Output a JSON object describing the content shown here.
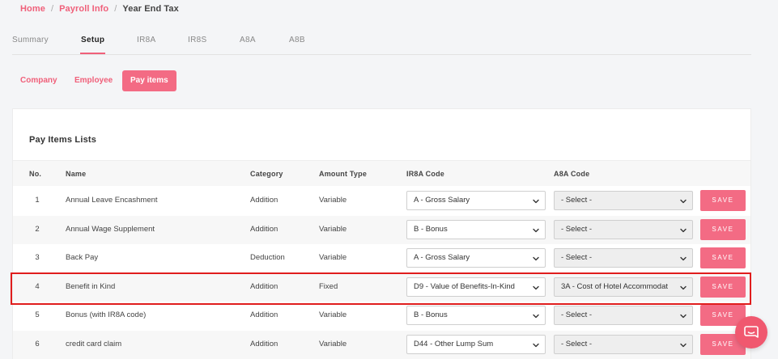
{
  "breadcrumb": {
    "home": "Home",
    "payroll": "Payroll Info",
    "current": "Year End Tax"
  },
  "tabs": [
    "Summary",
    "Setup",
    "IR8A",
    "IR8S",
    "A8A",
    "A8B"
  ],
  "active_tab": "Setup",
  "subtabs": [
    "Company",
    "Employee",
    "Pay items"
  ],
  "active_subtab": "Pay items",
  "card_title": "Pay Items Lists",
  "columns": {
    "no": "No.",
    "name": "Name",
    "category": "Category",
    "amount_type": "Amount Type",
    "ir8a": "IR8A Code",
    "a8a": "A8A Code"
  },
  "rows": [
    {
      "no": "1",
      "name": "Annual Leave Encashment",
      "category": "Addition",
      "amount_type": "Variable",
      "ir8a": "A - Gross Salary",
      "a8a": "- Select -",
      "save": "SAVE"
    },
    {
      "no": "2",
      "name": "Annual Wage Supplement",
      "category": "Addition",
      "amount_type": "Variable",
      "ir8a": "B - Bonus",
      "a8a": "- Select -",
      "save": "SAVE"
    },
    {
      "no": "3",
      "name": "Back Pay",
      "category": "Deduction",
      "amount_type": "Variable",
      "ir8a": "A - Gross Salary",
      "a8a": "- Select -",
      "save": "SAVE"
    },
    {
      "no": "4",
      "name": "Benefit in Kind",
      "category": "Addition",
      "amount_type": "Fixed",
      "ir8a": "D9 - Value of Benefits-In-Kind",
      "a8a": "3A - Cost of Hotel Accommodat",
      "save": "SAVE"
    },
    {
      "no": "5",
      "name": "Bonus (with IR8A code)",
      "category": "Addition",
      "amount_type": "Variable",
      "ir8a": "B - Bonus",
      "a8a": "- Select -",
      "save": "SAVE"
    },
    {
      "no": "6",
      "name": "credit card claim",
      "category": "Addition",
      "amount_type": "Variable",
      "ir8a": "D44 - Other Lump Sum",
      "a8a": "- Select -",
      "save": "SAVE"
    }
  ],
  "colors": {
    "accent": "#f36b84",
    "highlight": "#e01d1d",
    "chat": "#f0586f"
  },
  "icons": {
    "select": "chevron-down-icon",
    "chat": "chat-bubble-icon"
  }
}
